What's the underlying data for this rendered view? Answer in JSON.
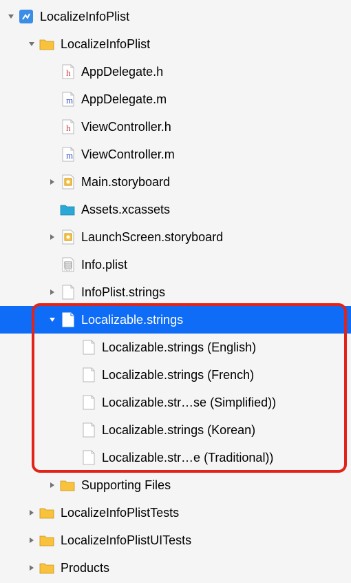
{
  "tree": {
    "root": {
      "name": "LocalizeInfoPlist",
      "icon": "project",
      "expanded": true,
      "children": [
        {
          "name": "LocalizeInfoPlist",
          "icon": "folder",
          "expanded": true,
          "children": [
            {
              "name": "AppDelegate.h",
              "icon": "h-file"
            },
            {
              "name": "AppDelegate.m",
              "icon": "m-file"
            },
            {
              "name": "ViewController.h",
              "icon": "h-file"
            },
            {
              "name": "ViewController.m",
              "icon": "m-file"
            },
            {
              "name": "Main.storyboard",
              "icon": "storyboard",
              "expandable": true
            },
            {
              "name": "Assets.xcassets",
              "icon": "xcassets"
            },
            {
              "name": "LaunchScreen.storyboard",
              "icon": "storyboard",
              "expandable": true
            },
            {
              "name": "Info.plist",
              "icon": "plist"
            },
            {
              "name": "InfoPlist.strings",
              "icon": "strings",
              "expandable": true
            },
            {
              "name": "Localizable.strings",
              "icon": "strings",
              "expanded": true,
              "selected": true,
              "children": [
                {
                  "name": "Localizable.strings (English)",
                  "icon": "strings"
                },
                {
                  "name": "Localizable.strings (French)",
                  "icon": "strings"
                },
                {
                  "name": "Localizable.str…se (Simplified))",
                  "icon": "strings"
                },
                {
                  "name": "Localizable.strings (Korean)",
                  "icon": "strings"
                },
                {
                  "name": "Localizable.str…e (Traditional))",
                  "icon": "strings"
                }
              ]
            },
            {
              "name": "Supporting Files",
              "icon": "folder",
              "expandable": true
            }
          ]
        },
        {
          "name": "LocalizeInfoPlistTests",
          "icon": "folder",
          "expandable": true
        },
        {
          "name": "LocalizeInfoPlistUITests",
          "icon": "folder",
          "expandable": true
        },
        {
          "name": "Products",
          "icon": "folder",
          "expandable": true
        }
      ]
    }
  }
}
